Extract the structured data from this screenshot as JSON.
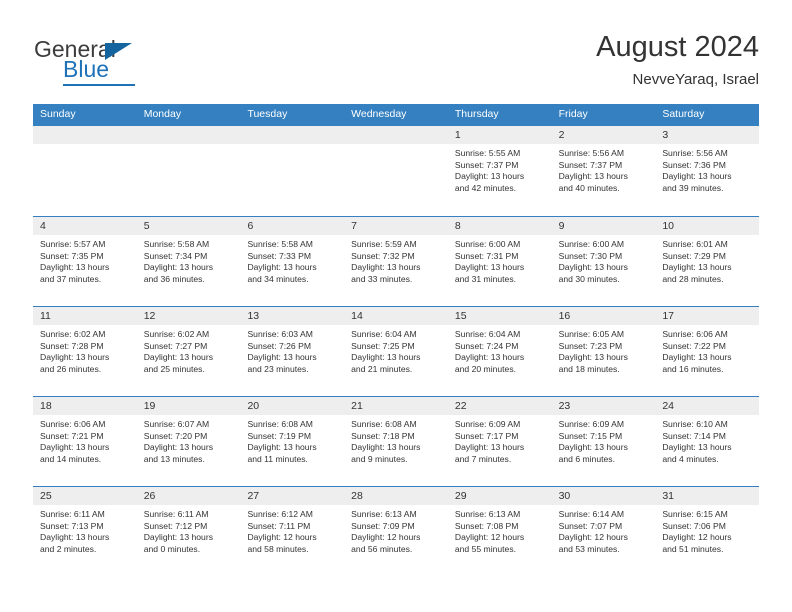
{
  "brand": {
    "name_part1": "General",
    "name_part2": "Blue",
    "logo_icon": "triangle-icon"
  },
  "header": {
    "title": "August 2024",
    "subtitle": "NevveYaraq, Israel"
  },
  "colors": {
    "header_blue": "#3580c0",
    "brand_blue": "#1f72b8",
    "date_band": "#eeeeee",
    "text": "#333333"
  },
  "weekdays": [
    "Sunday",
    "Monday",
    "Tuesday",
    "Wednesday",
    "Thursday",
    "Friday",
    "Saturday"
  ],
  "weeks": [
    [
      {
        "day": "",
        "sunrise": "",
        "sunset": "",
        "daylight_line1": "",
        "daylight_line2": ""
      },
      {
        "day": "",
        "sunrise": "",
        "sunset": "",
        "daylight_line1": "",
        "daylight_line2": ""
      },
      {
        "day": "",
        "sunrise": "",
        "sunset": "",
        "daylight_line1": "",
        "daylight_line2": ""
      },
      {
        "day": "",
        "sunrise": "",
        "sunset": "",
        "daylight_line1": "",
        "daylight_line2": ""
      },
      {
        "day": "1",
        "sunrise": "Sunrise: 5:55 AM",
        "sunset": "Sunset: 7:37 PM",
        "daylight_line1": "Daylight: 13 hours",
        "daylight_line2": "and 42 minutes."
      },
      {
        "day": "2",
        "sunrise": "Sunrise: 5:56 AM",
        "sunset": "Sunset: 7:37 PM",
        "daylight_line1": "Daylight: 13 hours",
        "daylight_line2": "and 40 minutes."
      },
      {
        "day": "3",
        "sunrise": "Sunrise: 5:56 AM",
        "sunset": "Sunset: 7:36 PM",
        "daylight_line1": "Daylight: 13 hours",
        "daylight_line2": "and 39 minutes."
      }
    ],
    [
      {
        "day": "4",
        "sunrise": "Sunrise: 5:57 AM",
        "sunset": "Sunset: 7:35 PM",
        "daylight_line1": "Daylight: 13 hours",
        "daylight_line2": "and 37 minutes."
      },
      {
        "day": "5",
        "sunrise": "Sunrise: 5:58 AM",
        "sunset": "Sunset: 7:34 PM",
        "daylight_line1": "Daylight: 13 hours",
        "daylight_line2": "and 36 minutes."
      },
      {
        "day": "6",
        "sunrise": "Sunrise: 5:58 AM",
        "sunset": "Sunset: 7:33 PM",
        "daylight_line1": "Daylight: 13 hours",
        "daylight_line2": "and 34 minutes."
      },
      {
        "day": "7",
        "sunrise": "Sunrise: 5:59 AM",
        "sunset": "Sunset: 7:32 PM",
        "daylight_line1": "Daylight: 13 hours",
        "daylight_line2": "and 33 minutes."
      },
      {
        "day": "8",
        "sunrise": "Sunrise: 6:00 AM",
        "sunset": "Sunset: 7:31 PM",
        "daylight_line1": "Daylight: 13 hours",
        "daylight_line2": "and 31 minutes."
      },
      {
        "day": "9",
        "sunrise": "Sunrise: 6:00 AM",
        "sunset": "Sunset: 7:30 PM",
        "daylight_line1": "Daylight: 13 hours",
        "daylight_line2": "and 30 minutes."
      },
      {
        "day": "10",
        "sunrise": "Sunrise: 6:01 AM",
        "sunset": "Sunset: 7:29 PM",
        "daylight_line1": "Daylight: 13 hours",
        "daylight_line2": "and 28 minutes."
      }
    ],
    [
      {
        "day": "11",
        "sunrise": "Sunrise: 6:02 AM",
        "sunset": "Sunset: 7:28 PM",
        "daylight_line1": "Daylight: 13 hours",
        "daylight_line2": "and 26 minutes."
      },
      {
        "day": "12",
        "sunrise": "Sunrise: 6:02 AM",
        "sunset": "Sunset: 7:27 PM",
        "daylight_line1": "Daylight: 13 hours",
        "daylight_line2": "and 25 minutes."
      },
      {
        "day": "13",
        "sunrise": "Sunrise: 6:03 AM",
        "sunset": "Sunset: 7:26 PM",
        "daylight_line1": "Daylight: 13 hours",
        "daylight_line2": "and 23 minutes."
      },
      {
        "day": "14",
        "sunrise": "Sunrise: 6:04 AM",
        "sunset": "Sunset: 7:25 PM",
        "daylight_line1": "Daylight: 13 hours",
        "daylight_line2": "and 21 minutes."
      },
      {
        "day": "15",
        "sunrise": "Sunrise: 6:04 AM",
        "sunset": "Sunset: 7:24 PM",
        "daylight_line1": "Daylight: 13 hours",
        "daylight_line2": "and 20 minutes."
      },
      {
        "day": "16",
        "sunrise": "Sunrise: 6:05 AM",
        "sunset": "Sunset: 7:23 PM",
        "daylight_line1": "Daylight: 13 hours",
        "daylight_line2": "and 18 minutes."
      },
      {
        "day": "17",
        "sunrise": "Sunrise: 6:06 AM",
        "sunset": "Sunset: 7:22 PM",
        "daylight_line1": "Daylight: 13 hours",
        "daylight_line2": "and 16 minutes."
      }
    ],
    [
      {
        "day": "18",
        "sunrise": "Sunrise: 6:06 AM",
        "sunset": "Sunset: 7:21 PM",
        "daylight_line1": "Daylight: 13 hours",
        "daylight_line2": "and 14 minutes."
      },
      {
        "day": "19",
        "sunrise": "Sunrise: 6:07 AM",
        "sunset": "Sunset: 7:20 PM",
        "daylight_line1": "Daylight: 13 hours",
        "daylight_line2": "and 13 minutes."
      },
      {
        "day": "20",
        "sunrise": "Sunrise: 6:08 AM",
        "sunset": "Sunset: 7:19 PM",
        "daylight_line1": "Daylight: 13 hours",
        "daylight_line2": "and 11 minutes."
      },
      {
        "day": "21",
        "sunrise": "Sunrise: 6:08 AM",
        "sunset": "Sunset: 7:18 PM",
        "daylight_line1": "Daylight: 13 hours",
        "daylight_line2": "and 9 minutes."
      },
      {
        "day": "22",
        "sunrise": "Sunrise: 6:09 AM",
        "sunset": "Sunset: 7:17 PM",
        "daylight_line1": "Daylight: 13 hours",
        "daylight_line2": "and 7 minutes."
      },
      {
        "day": "23",
        "sunrise": "Sunrise: 6:09 AM",
        "sunset": "Sunset: 7:15 PM",
        "daylight_line1": "Daylight: 13 hours",
        "daylight_line2": "and 6 minutes."
      },
      {
        "day": "24",
        "sunrise": "Sunrise: 6:10 AM",
        "sunset": "Sunset: 7:14 PM",
        "daylight_line1": "Daylight: 13 hours",
        "daylight_line2": "and 4 minutes."
      }
    ],
    [
      {
        "day": "25",
        "sunrise": "Sunrise: 6:11 AM",
        "sunset": "Sunset: 7:13 PM",
        "daylight_line1": "Daylight: 13 hours",
        "daylight_line2": "and 2 minutes."
      },
      {
        "day": "26",
        "sunrise": "Sunrise: 6:11 AM",
        "sunset": "Sunset: 7:12 PM",
        "daylight_line1": "Daylight: 13 hours",
        "daylight_line2": "and 0 minutes."
      },
      {
        "day": "27",
        "sunrise": "Sunrise: 6:12 AM",
        "sunset": "Sunset: 7:11 PM",
        "daylight_line1": "Daylight: 12 hours",
        "daylight_line2": "and 58 minutes."
      },
      {
        "day": "28",
        "sunrise": "Sunrise: 6:13 AM",
        "sunset": "Sunset: 7:09 PM",
        "daylight_line1": "Daylight: 12 hours",
        "daylight_line2": "and 56 minutes."
      },
      {
        "day": "29",
        "sunrise": "Sunrise: 6:13 AM",
        "sunset": "Sunset: 7:08 PM",
        "daylight_line1": "Daylight: 12 hours",
        "daylight_line2": "and 55 minutes."
      },
      {
        "day": "30",
        "sunrise": "Sunrise: 6:14 AM",
        "sunset": "Sunset: 7:07 PM",
        "daylight_line1": "Daylight: 12 hours",
        "daylight_line2": "and 53 minutes."
      },
      {
        "day": "31",
        "sunrise": "Sunrise: 6:15 AM",
        "sunset": "Sunset: 7:06 PM",
        "daylight_line1": "Daylight: 12 hours",
        "daylight_line2": "and 51 minutes."
      }
    ]
  ]
}
